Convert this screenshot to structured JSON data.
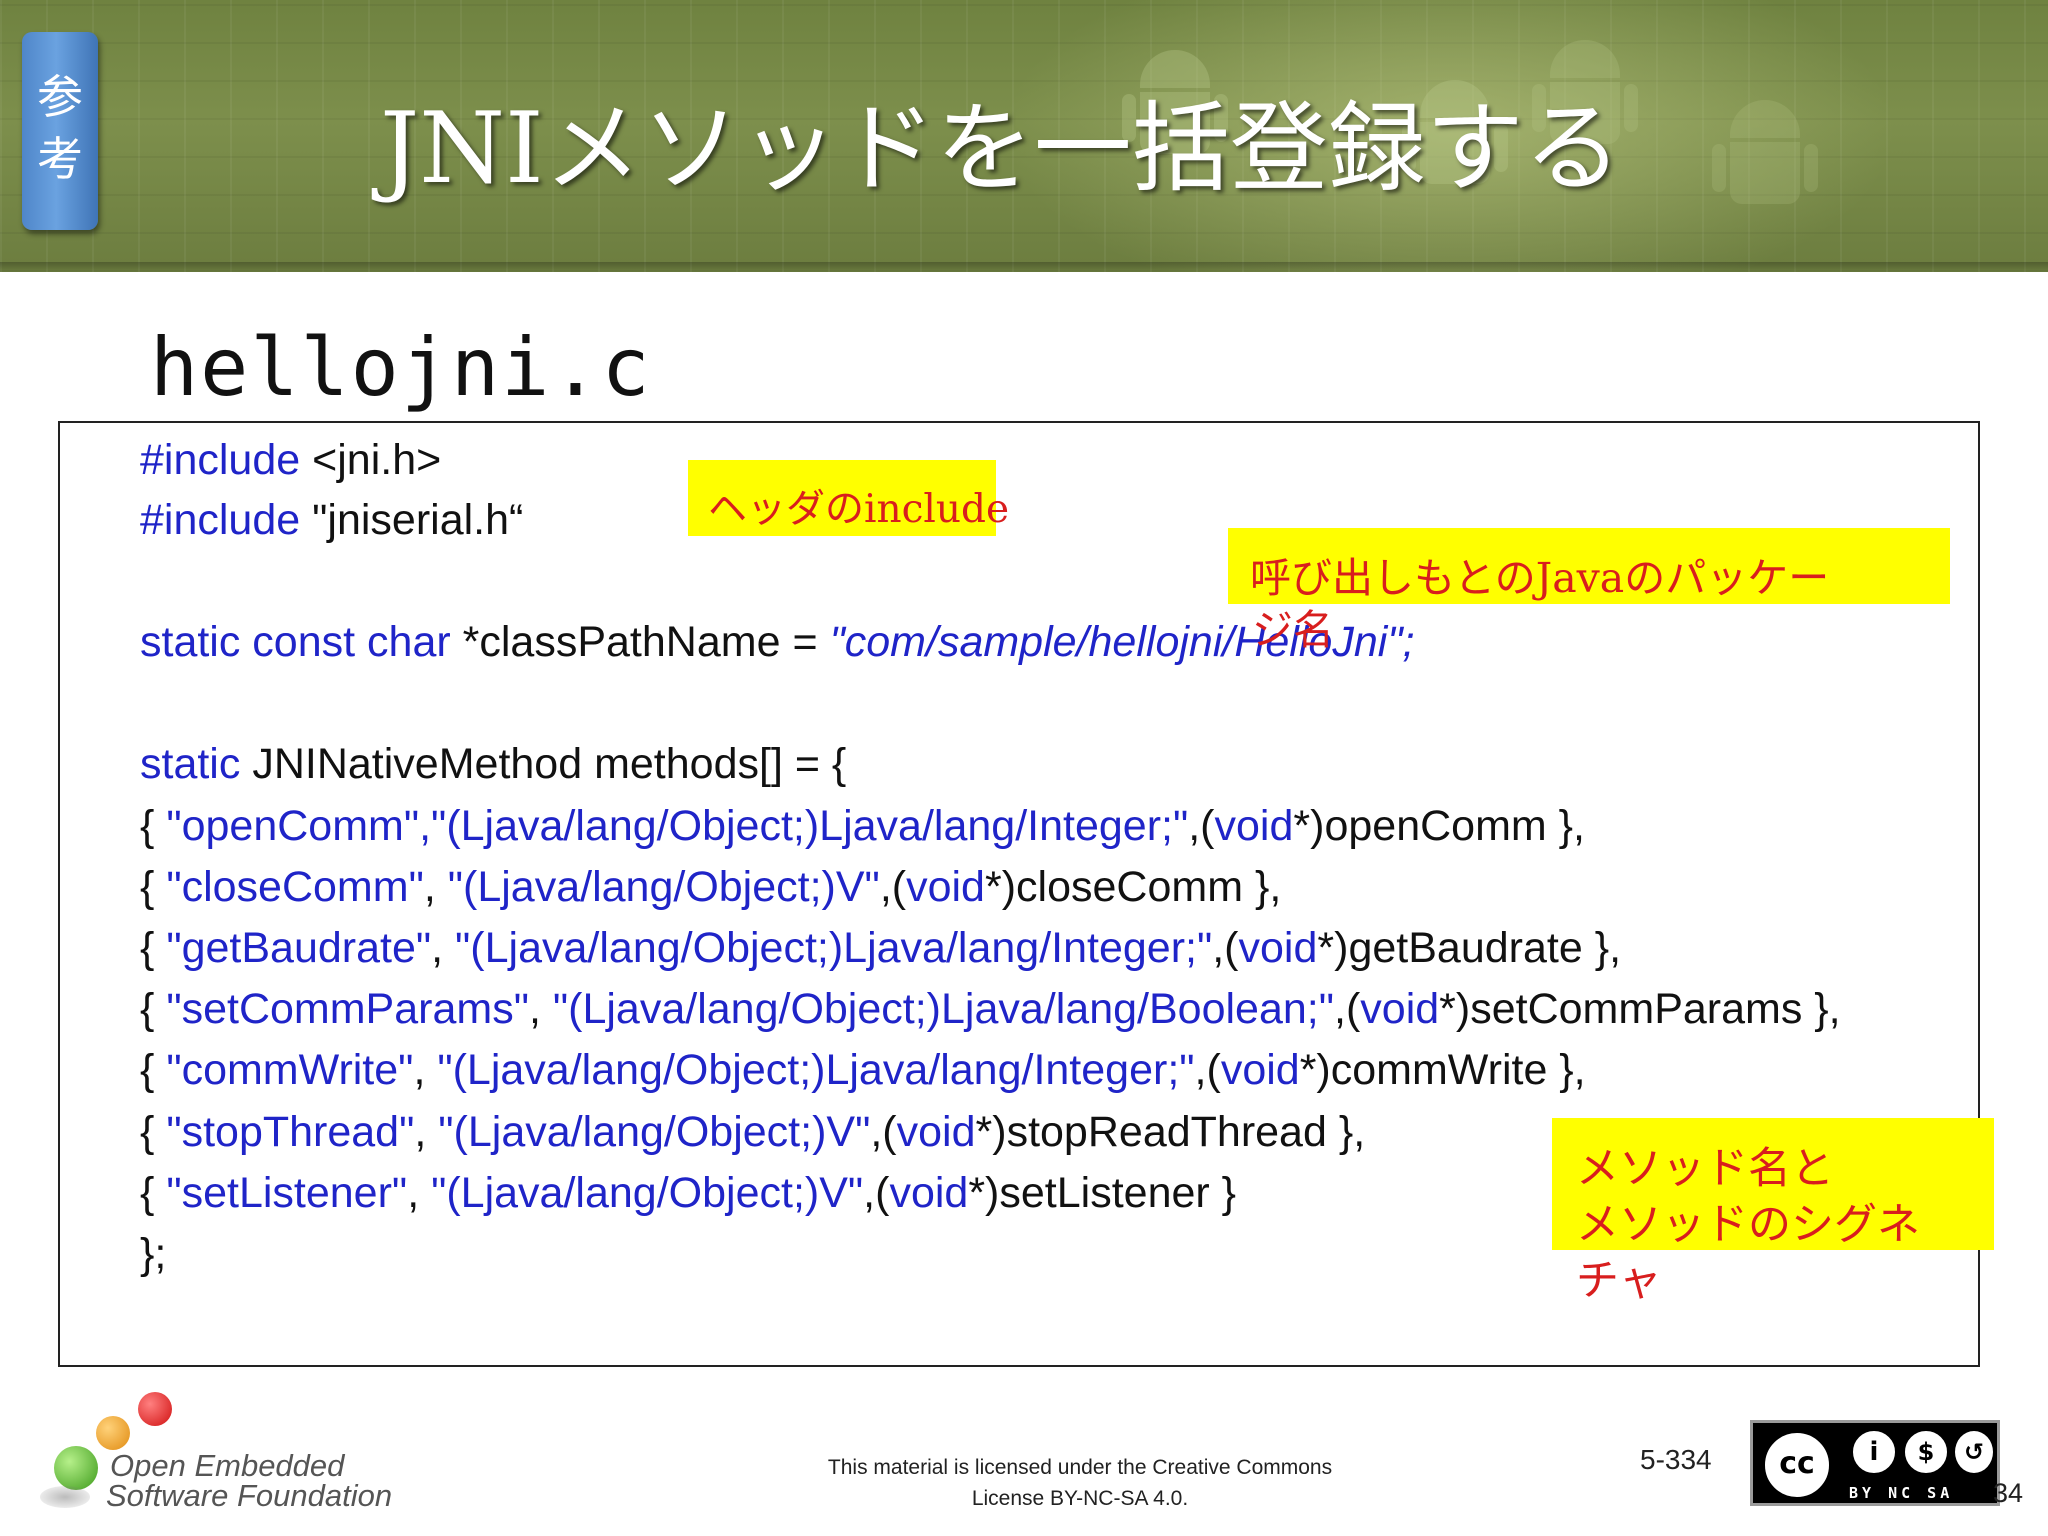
{
  "header": {
    "badge": [
      "参",
      "考"
    ],
    "title": "JNIメソッドを一括登録する"
  },
  "filename": "hellojni.c",
  "code": {
    "lines": [
      [
        {
          "t": "#include",
          "c": "kw"
        },
        {
          "t": " <jni.h>",
          "c": "plain"
        }
      ],
      [
        {
          "t": "#include",
          "c": "kw"
        },
        {
          "t": " \"jniserial.h“",
          "c": "plain"
        }
      ],
      [],
      [
        {
          "t": "static const char",
          "c": "kw"
        },
        {
          "t": " *classPathName = ",
          "c": "plain"
        },
        {
          "t": "\"com/sample/hellojni/HelloJni\";",
          "c": "ital"
        }
      ],
      [],
      [
        {
          "t": "static",
          "c": "kw"
        },
        {
          "t": " JNINativeMethod methods[] = {",
          "c": "plain"
        }
      ],
      [
        {
          "t": "{ ",
          "c": "plain"
        },
        {
          "t": "\"openComm\",\"(Ljava/lang/Object;)Ljava/lang/Integer;\"",
          "c": "str"
        },
        {
          "t": ",(",
          "c": "plain"
        },
        {
          "t": "void",
          "c": "kw"
        },
        {
          "t": "*)openComm },",
          "c": "plain"
        }
      ],
      [
        {
          "t": "{ ",
          "c": "plain"
        },
        {
          "t": "\"closeComm\"",
          "c": "str"
        },
        {
          "t": ", ",
          "c": "plain"
        },
        {
          "t": "\"(Ljava/lang/Object;)V\"",
          "c": "str"
        },
        {
          "t": ",(",
          "c": "plain"
        },
        {
          "t": "void",
          "c": "kw"
        },
        {
          "t": "*)closeComm },",
          "c": "plain"
        }
      ],
      [
        {
          "t": "{ ",
          "c": "plain"
        },
        {
          "t": "\"getBaudrate\"",
          "c": "str"
        },
        {
          "t": ", ",
          "c": "plain"
        },
        {
          "t": "\"(Ljava/lang/Object;)Ljava/lang/Integer;\"",
          "c": "str"
        },
        {
          "t": ",(",
          "c": "plain"
        },
        {
          "t": "void",
          "c": "kw"
        },
        {
          "t": "*)getBaudrate },",
          "c": "plain"
        }
      ],
      [
        {
          "t": "{ ",
          "c": "plain"
        },
        {
          "t": "\"setCommParams\"",
          "c": "str"
        },
        {
          "t": ", ",
          "c": "plain"
        },
        {
          "t": "\"(Ljava/lang/Object;)Ljava/lang/Boolean;\"",
          "c": "str"
        },
        {
          "t": ",(",
          "c": "plain"
        },
        {
          "t": "void",
          "c": "kw"
        },
        {
          "t": "*)setCommParams },",
          "c": "plain"
        }
      ],
      [
        {
          "t": "{ ",
          "c": "plain"
        },
        {
          "t": "\"commWrite\"",
          "c": "str"
        },
        {
          "t": ", ",
          "c": "plain"
        },
        {
          "t": "\"(Ljava/lang/Object;)Ljava/lang/Integer;\"",
          "c": "str"
        },
        {
          "t": ",(",
          "c": "plain"
        },
        {
          "t": "void",
          "c": "kw"
        },
        {
          "t": "*)commWrite },",
          "c": "plain"
        }
      ],
      [
        {
          "t": "{ ",
          "c": "plain"
        },
        {
          "t": "\"stopThread\"",
          "c": "str"
        },
        {
          "t": ", ",
          "c": "plain"
        },
        {
          "t": "\"(Ljava/lang/Object;)V\"",
          "c": "str"
        },
        {
          "t": ",(",
          "c": "plain"
        },
        {
          "t": "void",
          "c": "kw"
        },
        {
          "t": "*)stopReadThread },",
          "c": "plain"
        }
      ],
      [
        {
          "t": "{ ",
          "c": "plain"
        },
        {
          "t": "\"setListener\"",
          "c": "str"
        },
        {
          "t": ", ",
          "c": "plain"
        },
        {
          "t": "\"(Ljava/lang/Object;)V\"",
          "c": "str"
        },
        {
          "t": ",(",
          "c": "plain"
        },
        {
          "t": "void",
          "c": "kw"
        },
        {
          "t": "*)setListener }",
          "c": "plain"
        }
      ],
      [
        {
          "t": "};",
          "c": "plain"
        }
      ]
    ]
  },
  "annotations": {
    "header_include": "ヘッダのinclude",
    "java_package_1": "呼び出しもとのJavaのパッケー",
    "java_package_2": "ジ名",
    "method_sig_1": "メソッド名と",
    "method_sig_2": "メソッドのシグネ",
    "method_sig_3": "チャ"
  },
  "footer": {
    "logo_line1": "Open Embedded",
    "logo_line2": "Software Foundation",
    "license_line1": "This material is licensed under the Creative Commons",
    "license_line2": "License BY-NC-SA 4.0.",
    "page_number": "5-334",
    "corner_number": "34",
    "cc_badge": "BY NC SA"
  },
  "colors": {
    "keyword": "#1f24c8",
    "annotation_bg": "#ffff00",
    "annotation_text": "#d81e1e"
  }
}
